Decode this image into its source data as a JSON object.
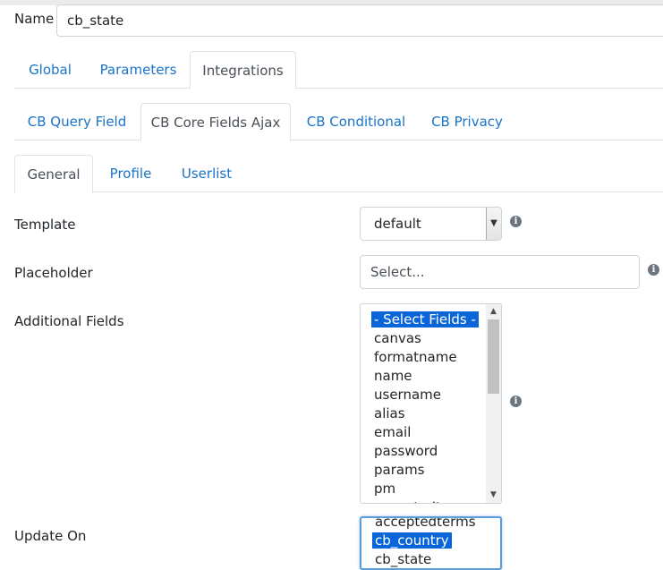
{
  "name_field": {
    "label": "Name",
    "value": "cb_state"
  },
  "tabs_level1": [
    "Global",
    "Parameters",
    "Integrations"
  ],
  "tabs_level2": [
    "CB Query Field",
    "CB Core Fields Ajax",
    "CB Conditional",
    "CB Privacy"
  ],
  "tabs_level3": [
    "General",
    "Profile",
    "Userlist"
  ],
  "template": {
    "label": "Template",
    "value": "default"
  },
  "placeholder": {
    "label": "Placeholder",
    "value": "Select..."
  },
  "additional_fields": {
    "label": "Additional Fields",
    "options": [
      "- Select Fields -",
      "canvas",
      "formatname",
      "name",
      "username",
      "alias",
      "email",
      "password",
      "params",
      "pm",
      "acceptedterms"
    ],
    "selected": "- Select Fields -"
  },
  "update_on": {
    "label": "Update On",
    "options": [
      "acceptedterms",
      "cb_country",
      "cb_state"
    ],
    "selected": "cb_country"
  },
  "info_icon_glyph": "i"
}
